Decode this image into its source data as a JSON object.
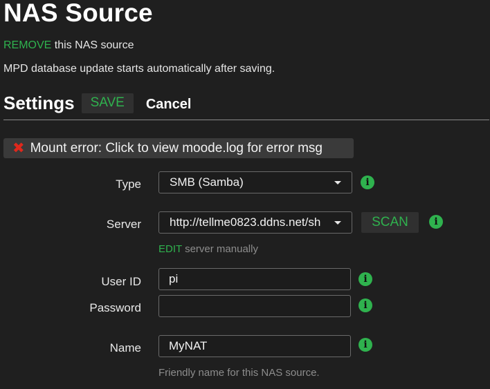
{
  "page": {
    "title": "NAS Source",
    "remove_link": "REMOVE",
    "remove_suffix": " this NAS source",
    "info_text": "MPD database update starts automatically after saving."
  },
  "settings": {
    "heading": "Settings",
    "save_label": "SAVE",
    "cancel_label": "Cancel"
  },
  "error": {
    "icon": "x-icon",
    "message": "Mount error: Click to view moode.log for error msg"
  },
  "form": {
    "type": {
      "label": "Type",
      "value": "SMB (Samba)"
    },
    "server": {
      "label": "Server",
      "value": "http://tellme0823.ddns.net/sh",
      "scan_label": "SCAN",
      "edit_link": "EDIT",
      "edit_suffix": " server manually"
    },
    "userid": {
      "label": "User ID",
      "value": "pi"
    },
    "password": {
      "label": "Password",
      "value": ""
    },
    "name": {
      "label": "Name",
      "value": "MyNAT",
      "help": "Friendly name for this NAS source."
    },
    "info_glyph": "i"
  },
  "colors": {
    "accent": "#2fb24e",
    "error": "#e0281c",
    "background": "#1f1f1f"
  }
}
